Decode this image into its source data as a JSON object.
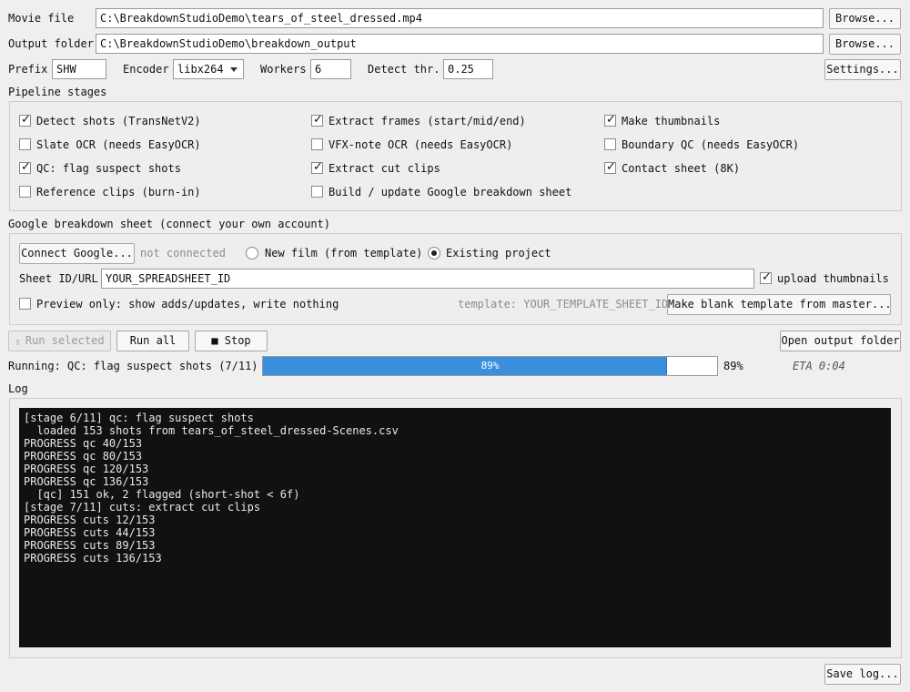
{
  "inputs": {
    "movie_file_label": "Movie file",
    "movie_file_value": "C:\\BreakdownStudioDemo\\tears_of_steel_dressed.mp4",
    "output_folder_label": "Output folder",
    "output_folder_value": "C:\\BreakdownStudioDemo\\breakdown_output",
    "browse_label": "Browse...",
    "prefix_label": "Prefix",
    "prefix_value": "SHW",
    "encoder_label": "Encoder",
    "encoder_value": "libx264",
    "workers_label": "Workers",
    "workers_value": "6",
    "detect_label": "Detect thr.",
    "detect_value": "0.25",
    "settings_label": "Settings..."
  },
  "stages": {
    "title": "Pipeline stages",
    "items": [
      {
        "label": "Detect shots (TransNetV2)",
        "checked": true
      },
      {
        "label": "Extract frames (start/mid/end)",
        "checked": true
      },
      {
        "label": "Make thumbnails",
        "checked": true
      },
      {
        "label": "Slate OCR (needs EasyOCR)",
        "checked": false
      },
      {
        "label": "VFX-note OCR (needs EasyOCR)",
        "checked": false
      },
      {
        "label": "Boundary QC (needs EasyOCR)",
        "checked": false
      },
      {
        "label": "QC: flag suspect shots",
        "checked": true
      },
      {
        "label": "Extract cut clips",
        "checked": true
      },
      {
        "label": "Contact sheet (8K)",
        "checked": true
      },
      {
        "label": "Reference clips (burn-in)",
        "checked": false
      },
      {
        "label": "Build / update Google breakdown sheet",
        "checked": false
      }
    ]
  },
  "google": {
    "title": "Google breakdown sheet  (connect your own account)",
    "connect_label": "Connect Google...",
    "status": "not connected",
    "radio_new": "New film (from template)",
    "radio_existing": "Existing project",
    "selected": "existing",
    "sheet_label": "Sheet ID/URL",
    "sheet_value": "YOUR_SPREADSHEET_ID",
    "upload_thumbnails_label": "upload thumbnails",
    "upload_thumbnails_checked": true,
    "preview_label": "Preview only: show adds/updates, write nothing",
    "preview_checked": false,
    "template_text": "template: YOUR_TEMPLATE_SHEET_ID",
    "make_template_label": "Make blank template from master..."
  },
  "controls": {
    "run_selected_label": "Run selected",
    "run_all_label": "Run all",
    "stop_label": "■ Stop",
    "open_output_label": "Open output folder"
  },
  "progress": {
    "running_text": "Running: QC: flag suspect shots  (7/11)",
    "percent": 89,
    "bar_text": "89%",
    "side_text": "89%",
    "eta": "ETA 0:04"
  },
  "log": {
    "title": "Log",
    "lines": [
      "[stage 6/11] qc: flag suspect shots",
      "  loaded 153 shots from tears_of_steel_dressed-Scenes.csv",
      "PROGRESS qc 40/153",
      "PROGRESS qc 80/153",
      "PROGRESS qc 120/153",
      "PROGRESS qc 136/153",
      "  [qc] 151 ok, 2 flagged (short-shot < 6f)",
      "[stage 7/11] cuts: extract cut clips",
      "PROGRESS cuts 12/153",
      "PROGRESS cuts 44/153",
      "PROGRESS cuts 89/153",
      "PROGRESS cuts 136/153"
    ],
    "save_label": "Save log..."
  }
}
